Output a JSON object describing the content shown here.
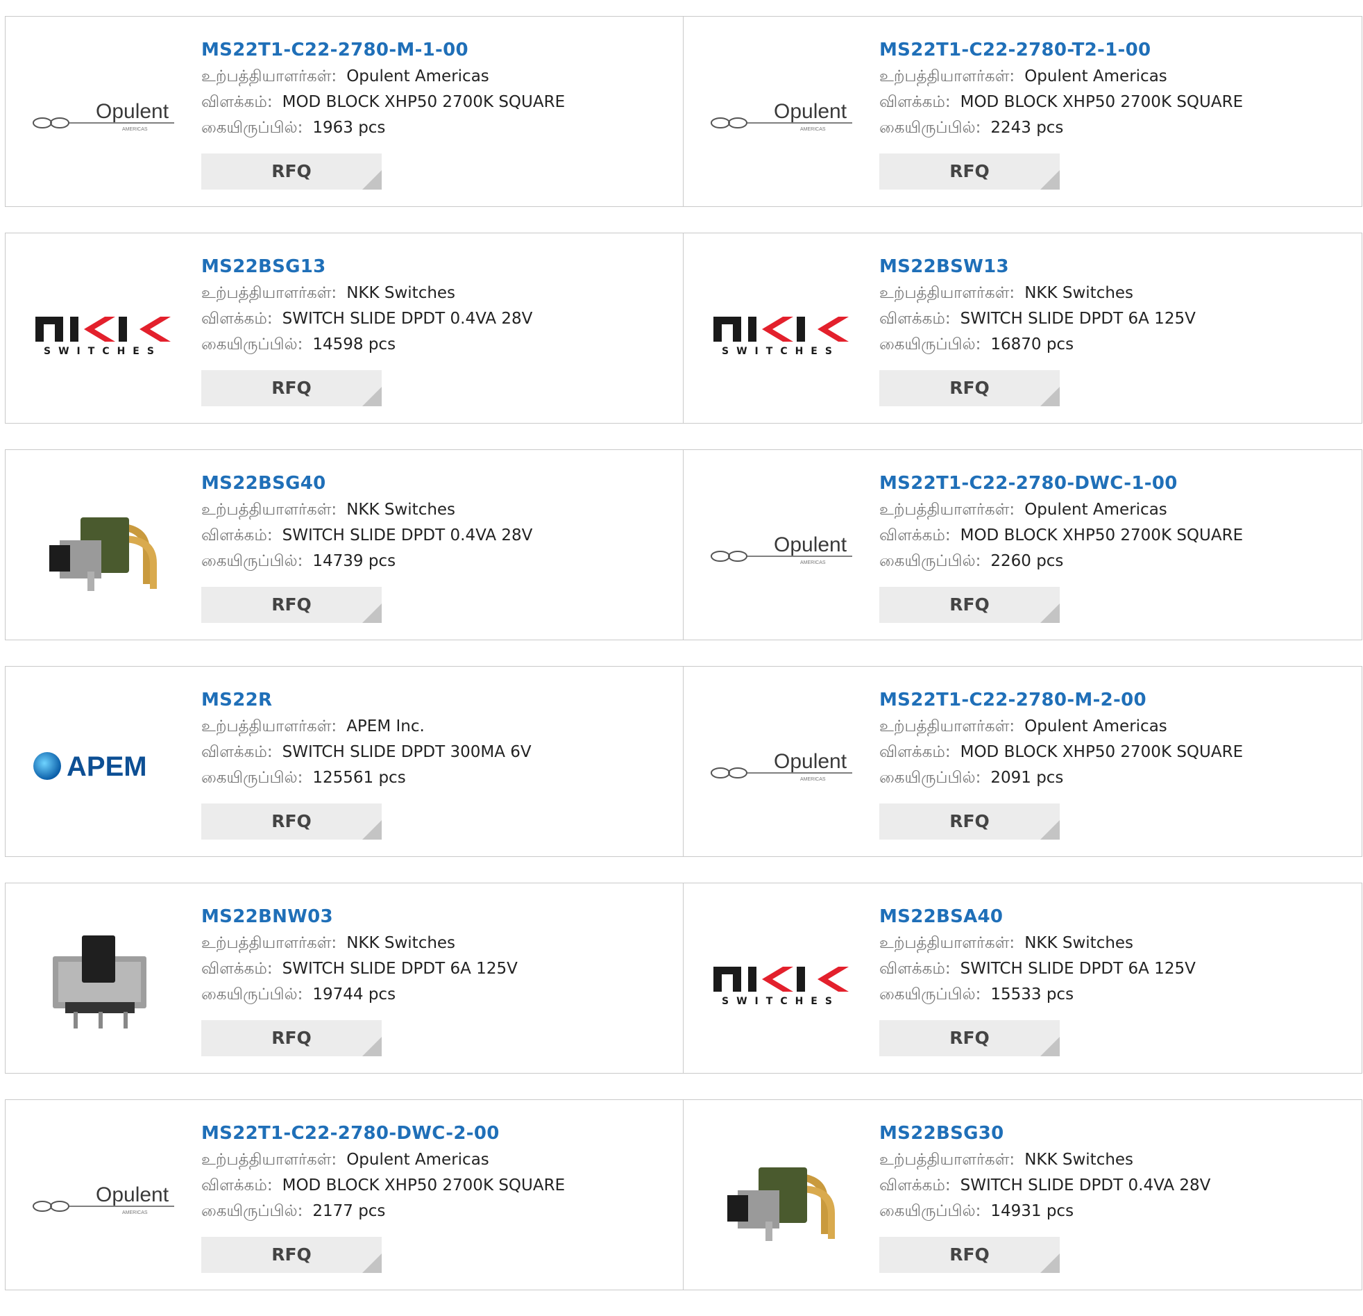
{
  "labels": {
    "manufacturer": "உற்பத்தியாளர்கள்:",
    "description": "விளக்கம்:",
    "stock": "கையிருப்பில்:",
    "rfq": "RFQ"
  },
  "logo_text": {
    "opulent": "Opulent",
    "opulent_sub": "AMERICAS",
    "nkk": "NKK",
    "nkk_sub": "SWITCHES",
    "apem": "APEM"
  },
  "colors": {
    "part_link": "#1f6fb8",
    "rfq_bg": "#ececec",
    "border": "#c9c9c9"
  },
  "products": [
    {
      "part": "MS22T1-C22-2780-M-1-00",
      "manufacturer": "Opulent Americas",
      "description": "MOD BLOCK XHP50 2700K SQUARE",
      "stock": "1963 pcs",
      "logo": "opulent"
    },
    {
      "part": "MS22T1-C22-2780-T2-1-00",
      "manufacturer": "Opulent Americas",
      "description": "MOD BLOCK XHP50 2700K SQUARE",
      "stock": "2243 pcs",
      "logo": "opulent"
    },
    {
      "part": "MS22BSG13",
      "manufacturer": "NKK Switches",
      "description": "SWITCH SLIDE DPDT 0.4VA 28V",
      "stock": "14598 pcs",
      "logo": "nkk"
    },
    {
      "part": "MS22BSW13",
      "manufacturer": "NKK Switches",
      "description": "SWITCH SLIDE DPDT 6A 125V",
      "stock": "16870 pcs",
      "logo": "nkk"
    },
    {
      "part": "MS22BSG40",
      "manufacturer": "NKK Switches",
      "description": "SWITCH SLIDE DPDT 0.4VA 28V",
      "stock": "14739 pcs",
      "logo": "switch-photo-angled"
    },
    {
      "part": "MS22T1-C22-2780-DWC-1-00",
      "manufacturer": "Opulent Americas",
      "description": "MOD BLOCK XHP50 2700K SQUARE",
      "stock": "2260 pcs",
      "logo": "opulent"
    },
    {
      "part": "MS22R",
      "manufacturer": "APEM Inc.",
      "description": "SWITCH SLIDE DPDT 300MA 6V",
      "stock": "125561 pcs",
      "logo": "apem"
    },
    {
      "part": "MS22T1-C22-2780-M-2-00",
      "manufacturer": "Opulent Americas",
      "description": "MOD BLOCK XHP50 2700K SQUARE",
      "stock": "2091 pcs",
      "logo": "opulent"
    },
    {
      "part": "MS22BNW03",
      "manufacturer": "NKK Switches",
      "description": "SWITCH SLIDE DPDT 6A 125V",
      "stock": "19744 pcs",
      "logo": "switch-photo-vertical"
    },
    {
      "part": "MS22BSA40",
      "manufacturer": "NKK Switches",
      "description": "SWITCH SLIDE DPDT 6A 125V",
      "stock": "15533 pcs",
      "logo": "nkk"
    },
    {
      "part": "MS22T1-C22-2780-DWC-2-00",
      "manufacturer": "Opulent Americas",
      "description": "MOD BLOCK XHP50 2700K SQUARE",
      "stock": "2177 pcs",
      "logo": "opulent"
    },
    {
      "part": "MS22BSG30",
      "manufacturer": "NKK Switches",
      "description": "SWITCH SLIDE DPDT 0.4VA 28V",
      "stock": "14931 pcs",
      "logo": "switch-photo-angled"
    }
  ]
}
